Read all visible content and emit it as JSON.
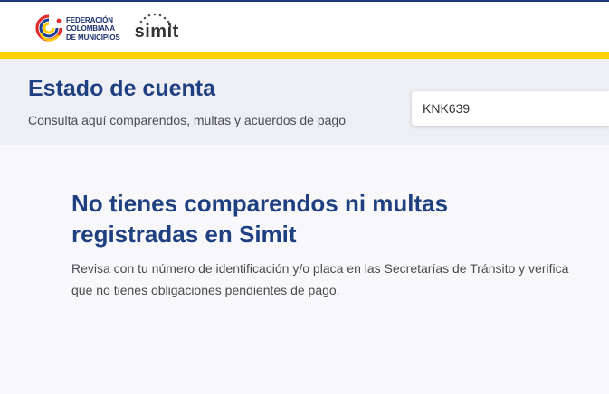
{
  "header": {
    "org_lines": [
      "FEDERACIÓN",
      "COLOMBIANA",
      "DE MUNICIPIOS"
    ],
    "simit_logo_text": "simit"
  },
  "account": {
    "title": "Estado de cuenta",
    "subtitle": "Consulta aquí comparendos, multas y acuerdos de pago",
    "plate_value": "KNK639"
  },
  "result": {
    "title": "No tienes comparendos ni multas registradas en Simit",
    "description": "Revisa con tu número de identificación y/o placa en las Secretarías de Tránsito y verifica que no tienes obligaciones pendientes de pago."
  },
  "colors": {
    "brand_blue": "#1e3f80",
    "accent_yellow": "#ffd200",
    "band_gray": "#eeeff4"
  }
}
